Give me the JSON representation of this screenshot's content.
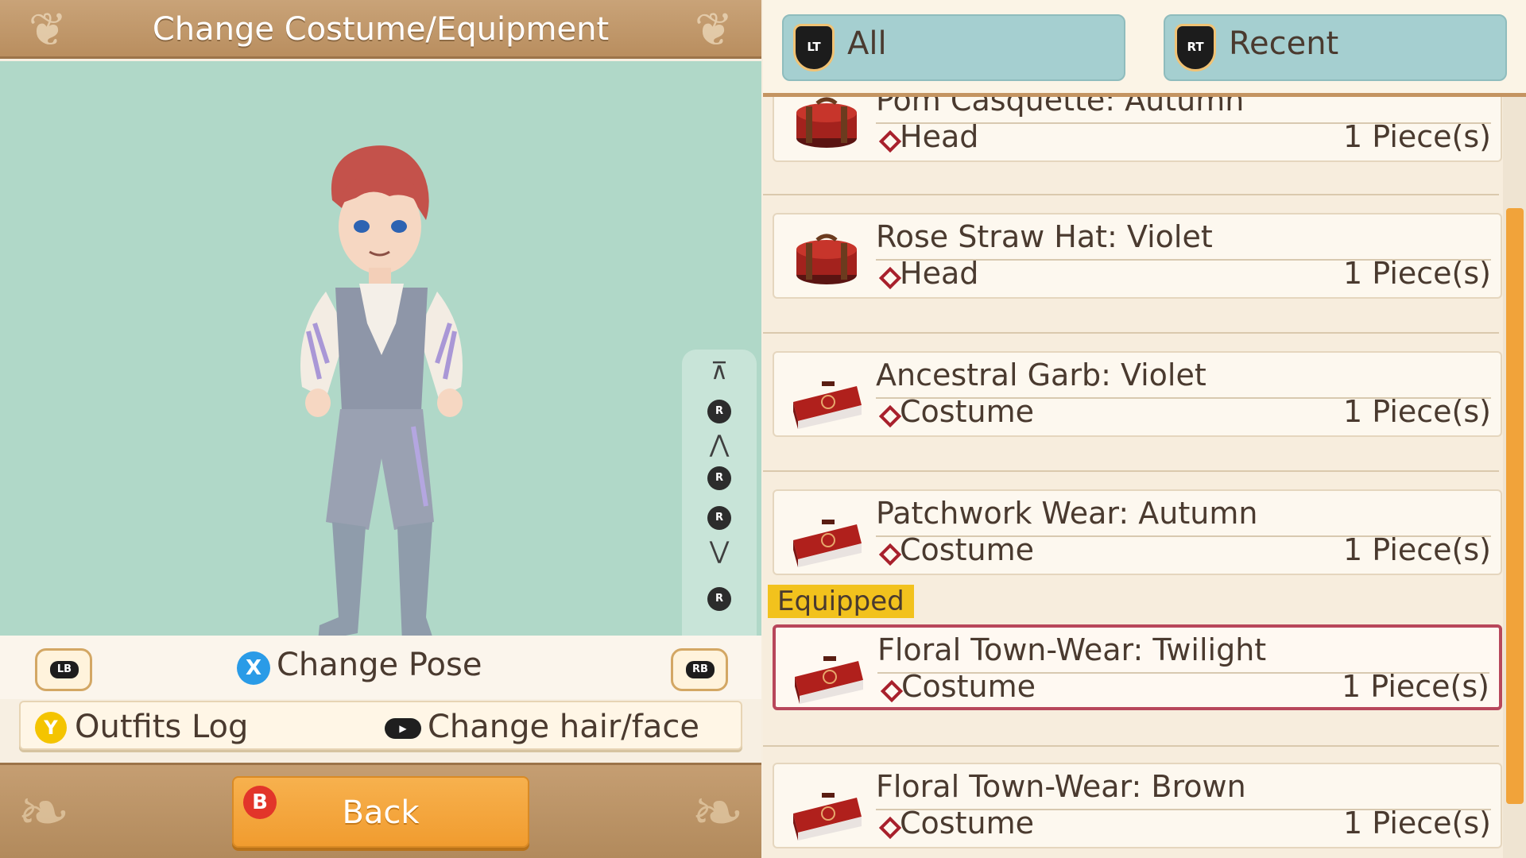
{
  "header": {
    "title": "Change Costume/Equipment"
  },
  "viewer": {
    "camera_controls": {
      "top": "⊼",
      "rotate_up": "R",
      "zoom_in": "⋀",
      "rotate_left": "R",
      "rotate_right": "R",
      "zoom_out": "⋁",
      "rotate_down": "R",
      "bottom": "⊻"
    }
  },
  "controls": {
    "lb": "LB",
    "rb": "RB",
    "x_key": "X",
    "change_pose": "Change Pose",
    "y_key": "Y",
    "outfits_log": "Outfits Log",
    "stick_key": "▶",
    "change_hair_face": "Change hair/face",
    "b_key": "B",
    "back": "Back"
  },
  "tabs": [
    {
      "key": "LT",
      "label": "All"
    },
    {
      "key": "RT",
      "label": "Recent"
    }
  ],
  "items": [
    {
      "name": "Pom Casquette: Autumn",
      "type": "Head",
      "qty": "1 Piece(s)",
      "icon": "hatbox-icon",
      "equipped": false
    },
    {
      "name": "Rose Straw Hat: Violet",
      "type": "Head",
      "qty": "1 Piece(s)",
      "icon": "hatbox-icon",
      "equipped": false
    },
    {
      "name": "Ancestral Garb: Violet",
      "type": "Costume",
      "qty": "1 Piece(s)",
      "icon": "suitcase-icon",
      "equipped": false
    },
    {
      "name": "Patchwork Wear: Autumn",
      "type": "Costume",
      "qty": "1 Piece(s)",
      "icon": "suitcase-icon",
      "equipped": false
    },
    {
      "name": "Floral Town-Wear: Twilight",
      "type": "Costume",
      "qty": "1 Piece(s)",
      "icon": "suitcase-icon",
      "equipped": true
    },
    {
      "name": "Floral Town-Wear: Brown",
      "type": "Costume",
      "qty": "1 Piece(s)",
      "icon": "suitcase-icon",
      "equipped": false
    }
  ],
  "equipped_label": "Equipped",
  "colors": {
    "viewer_bg": "#b0d8c8",
    "accent_orange": "#f1a33a",
    "equipped_border": "#b8475b",
    "equipped_tag": "#f2c21d",
    "tab_bg": "#a5cfd0"
  }
}
